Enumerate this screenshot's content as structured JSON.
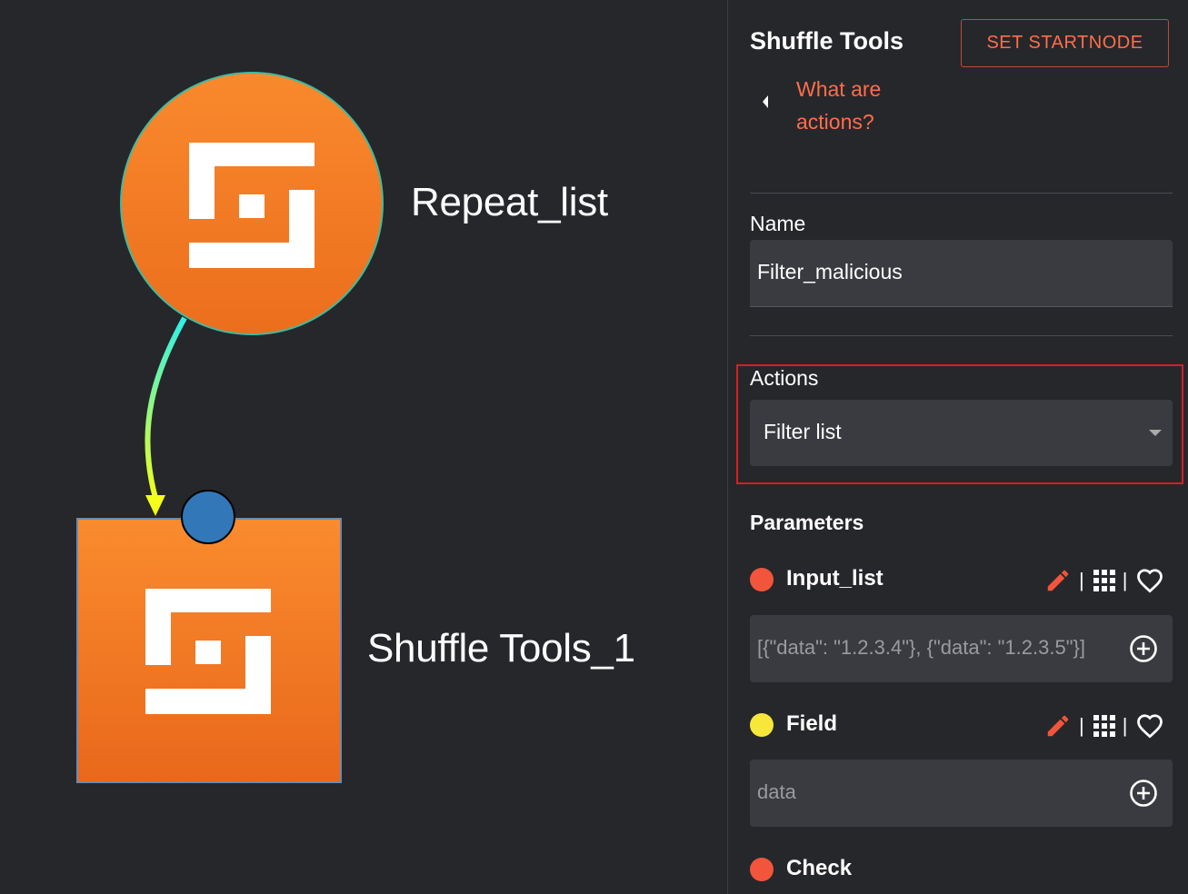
{
  "canvas": {
    "nodes": [
      {
        "label": "Repeat_list",
        "shape": "circle"
      },
      {
        "label": "Shuffle Tools_1",
        "shape": "square"
      }
    ],
    "colors": {
      "node": "#f58026",
      "edge_start": "#2ff0e8",
      "edge_end": "#f4ff1a",
      "handle": "#3278b8"
    }
  },
  "sidebar": {
    "app_title": "Shuffle Tools",
    "start_button": "SET STARTNODE",
    "help_link": "What are actions?",
    "name_label": "Name",
    "name_value": "Filter_malicious",
    "actions_label": "Actions",
    "action_selected": "Filter list",
    "parameters_label": "Parameters",
    "parameters": [
      {
        "name": "Input_list",
        "value": "[{\"data\": \"1.2.3.4\"}, {\"data\": \"1.2.3.5\"}]",
        "dot_color": "#f2553b"
      },
      {
        "name": "Field",
        "value": "data",
        "dot_color": "#f7e73a"
      },
      {
        "name": "Check",
        "value": "",
        "dot_color": "#f2553b"
      }
    ],
    "accent": "#ff6e4a",
    "highlight": "#d51f25"
  }
}
